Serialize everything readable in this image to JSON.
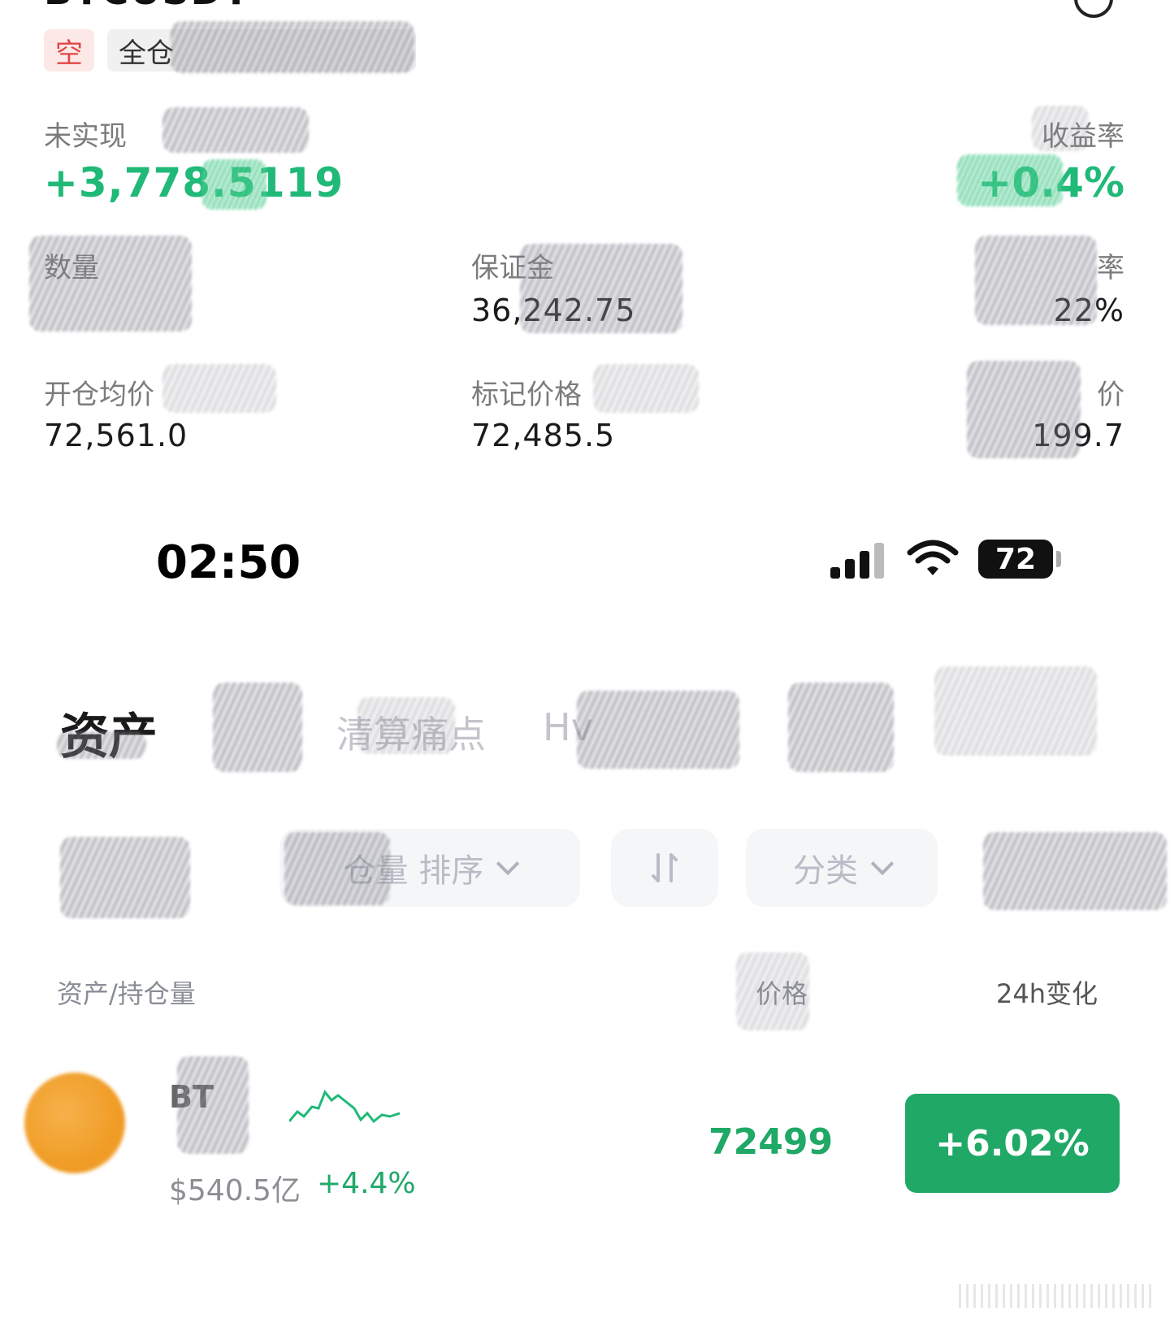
{
  "position": {
    "pair": "BTCUSDT",
    "side_tag": "空",
    "mode_tag": "全仓",
    "unrealized_label": "未实现",
    "unrealized_value": "+3,778.5119",
    "roe_label": "收益率",
    "roe_value": "+0.4%",
    "qty_label": "数量",
    "margin_label": "保证金",
    "margin_value": "36,242.75",
    "margin_ratio_label": "率",
    "margin_ratio_value": "22%",
    "entry_label": "开仓均价",
    "entry_value": "72,561.0",
    "mark_label": "标记价格",
    "mark_value": "72,485.5",
    "liq_label": "价",
    "liq_value": "199.7"
  },
  "status_bar": {
    "time": "02:50",
    "battery": "72"
  },
  "assets": {
    "tab_active": "资产",
    "tab_faded_1": "清算痛点",
    "tab_faded_2": "Hv",
    "filter_sort": "仓量 排序",
    "filter_category": "分类",
    "col_asset": "资产/持仓量",
    "col_price": "价格",
    "col_change": "24h变化",
    "row": {
      "symbol": "BT",
      "volume": "$540.5亿",
      "volume_change": "+4.4%",
      "price": "72499",
      "change_24h": "+6.02%"
    }
  },
  "colors": {
    "up_green": "#20b978",
    "short_red": "#e04848",
    "btc_orange": "#ef9a22"
  }
}
